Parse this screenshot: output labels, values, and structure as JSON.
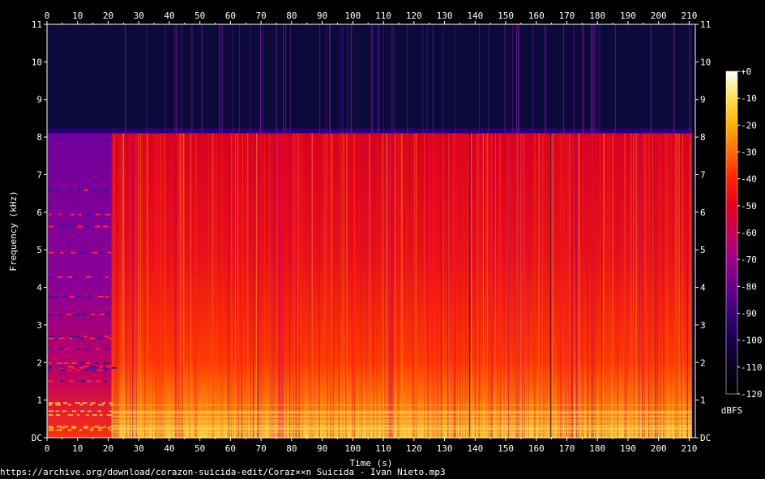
{
  "chart_data": {
    "type": "heatmap",
    "title": "",
    "xlabel": "Time (s)",
    "ylabel": "Frequency (kHz)",
    "xlim": [
      0,
      212
    ],
    "ylim": [
      0,
      11
    ],
    "x_ticks": [
      "0",
      "10",
      "20",
      "30",
      "40",
      "50",
      "60",
      "70",
      "80",
      "90",
      "100",
      "110",
      "120",
      "130",
      "140",
      "150",
      "160",
      "170",
      "180",
      "190",
      "200",
      "210"
    ],
    "y_ticks": [
      "DC",
      "1",
      "2",
      "3",
      "4",
      "5",
      "6",
      "7",
      "8",
      "9",
      "10",
      "11"
    ],
    "colorbar": {
      "label": "dBFS",
      "range": [
        -120,
        0
      ],
      "ticks": [
        "+0",
        "-10",
        "-20",
        "-30",
        "-40",
        "-50",
        "-60",
        "-70",
        "-80",
        "-90",
        "-100",
        "-110",
        "-120"
      ],
      "colors": [
        "#fffff0",
        "#ffe050",
        "#ffb000",
        "#ff6a00",
        "#ff2200",
        "#e8001e",
        "#c8005a",
        "#a0008a",
        "#6a0090",
        "#38007a",
        "#180050",
        "#080020",
        "#000000"
      ]
    },
    "description_regions": [
      {
        "t_start": 0,
        "t_end": 21,
        "f_max_khz": 8.1,
        "level_db": -75
      },
      {
        "t_start": 21,
        "t_end": 211,
        "f_max_khz": 8.1,
        "level_db": -50
      },
      {
        "t_start": 0,
        "t_end": 211,
        "f_min_khz": 8.1,
        "level_db": -110
      }
    ],
    "duration_s": 211,
    "cutoff_khz": 8.1
  },
  "footer": {
    "source_url": "https://archive.org/download/corazon-suicida-edit/Coraz××n Suicida - Ivan Nieto.mp3"
  }
}
